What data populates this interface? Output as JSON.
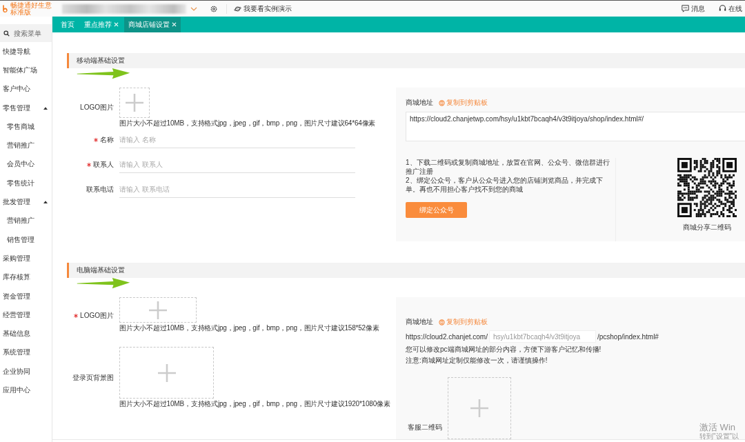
{
  "topbar": {
    "brand": "畅捷通好生意",
    "edition": "标准版",
    "demo_link": "我要看实例演示",
    "messages": "消息",
    "support": "在线"
  },
  "sidebar": {
    "search": {
      "placeholder": "搜索菜单"
    },
    "items": [
      {
        "label": "快捷导航"
      },
      {
        "label": "智能体广场"
      },
      {
        "label": "客户中心"
      },
      {
        "label": "零售管理",
        "expanded": true,
        "children": [
          {
            "label": "零售商城"
          },
          {
            "label": "营销推广"
          },
          {
            "label": "会员中心"
          },
          {
            "label": "零售统计"
          }
        ]
      },
      {
        "label": "批发管理",
        "expanded": true,
        "children": [
          {
            "label": "营销推广"
          },
          {
            "label": "销售管理"
          }
        ]
      },
      {
        "label": "采购管理"
      },
      {
        "label": "库存核算"
      },
      {
        "label": "资金管理"
      },
      {
        "label": "经营管理"
      },
      {
        "label": "基础信息"
      },
      {
        "label": "系统管理"
      },
      {
        "label": "企业协同"
      },
      {
        "label": "应用中心"
      }
    ]
  },
  "tabs": [
    {
      "label": "首页",
      "closable": false,
      "selected": false
    },
    {
      "label": "重点推荐",
      "closable": true,
      "selected": false
    },
    {
      "label": "商城店铺设置",
      "closable": true,
      "selected": true
    }
  ],
  "mobile": {
    "title": "移动端基础设置",
    "logo": {
      "label": "LOGO图片",
      "required": false,
      "hint": "图片大小不超过10MB，支持格式jpg，jpeg，gif，bmp，png，图片尺寸建议64*64像素"
    },
    "fields": [
      {
        "label": "名称",
        "required": true,
        "placeholder": "请输入 名称"
      },
      {
        "label": "联系人",
        "required": true,
        "placeholder": "请输入 联系人"
      },
      {
        "label": "联系电话",
        "required": false,
        "placeholder": "请输入 联系电话"
      }
    ],
    "address_label": "商城地址",
    "copy_link": "复制到剪贴板",
    "url": "https://cloud2.chanjetwp.com/hsy/u1kbt7bcaqh4/v3t9itjoya/shop/index.html#/",
    "instructions": [
      "1、下载二维码或复制商城地址，放置在官网、公众号、微信群进行推广注册",
      "2、绑定公众号，客户从公众号进入您的店铺浏览商品，并完成下单。再也不用担心客户找不到您的商城"
    ],
    "bind_button": "绑定公众号",
    "qr_caption": "商城分享二维码"
  },
  "pc": {
    "title": "电脑端基础设置",
    "logo": {
      "label": "LOGO图片",
      "required": true,
      "hint": "图片大小不超过10MB，支持格式jpg，jpeg，gif，bmp，png，图片尺寸建议158*52像素"
    },
    "background": {
      "label": "登录页背景图",
      "required": false,
      "hint": "图片大小不超过10MB，支持格式jpg，jpeg，gif，bmp，png，图片尺寸建议1920*1080像素"
    },
    "address_label": "商城地址",
    "copy_link": "复制到剪贴板",
    "url_prefix": "https://cloud2.chanjet.com/",
    "url_field": "hsy/u1kbt7bcaqh4/v3t9itjoya",
    "url_suffix": "/pcshop/index.html#",
    "notes": [
      "您可以修改pc端商城网址的部分内容，方便下游客户记忆和传播!",
      "注意:商城网址定制仅能修改一次，请谨慎操作!"
    ],
    "service_qr_label": "客服二维码"
  },
  "os_notice": [
    "激活 Win",
    "转到\"设置\"以"
  ]
}
